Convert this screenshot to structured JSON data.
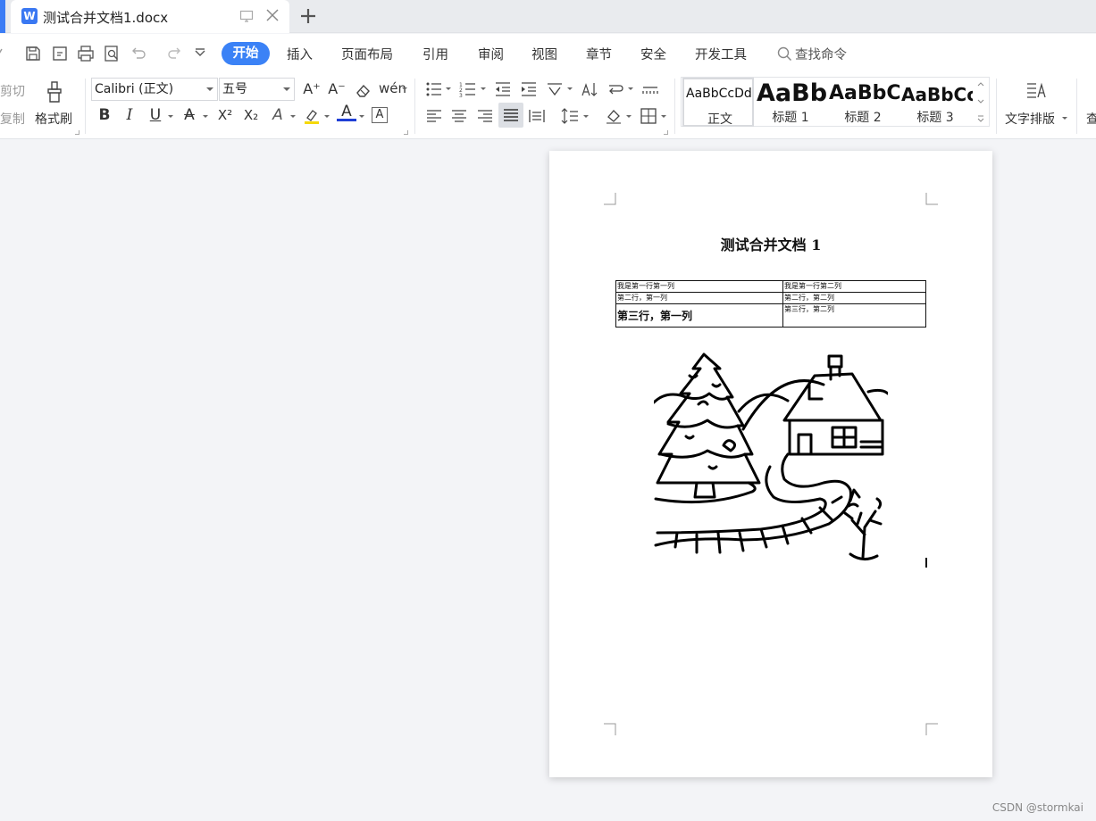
{
  "tab": {
    "title": "测试合并文档1.docx",
    "app_icon": "W"
  },
  "menu": {
    "active": "开始",
    "items": [
      "插入",
      "页面布局",
      "引用",
      "审阅",
      "视图",
      "章节",
      "安全",
      "开发工具"
    ],
    "search_label": "查找命令"
  },
  "ribbon": {
    "cut": "剪切",
    "copy": "复制",
    "format_painter": "格式刷",
    "font_name": "Calibri (正文)",
    "font_size": "五号",
    "text_layout": "文字排版",
    "styles": [
      {
        "sample": "AaBbCcDd",
        "name": "正文"
      },
      {
        "sample": "AaBb",
        "name": "标题 1"
      },
      {
        "sample": "AaBbC",
        "name": "标题 2"
      },
      {
        "sample": "AaBbCc",
        "name": "标题 3"
      }
    ],
    "bold": "B",
    "italic": "I",
    "underline": "U",
    "superscript": "X²",
    "subscript": "X₂"
  },
  "document": {
    "title": "测试合并文档 1",
    "table": [
      [
        "我是第一行第一列",
        "我是第一行第二列"
      ],
      [
        "第二行，第一列",
        "第二行，第二列"
      ],
      [
        "第三行，第一列",
        "第三行，第二列"
      ]
    ]
  },
  "watermark": "CSDN @stormkai",
  "colors": {
    "accent": "#3b82f6",
    "highlight": "#f5d90a",
    "font_color": "#1f3fd6"
  }
}
